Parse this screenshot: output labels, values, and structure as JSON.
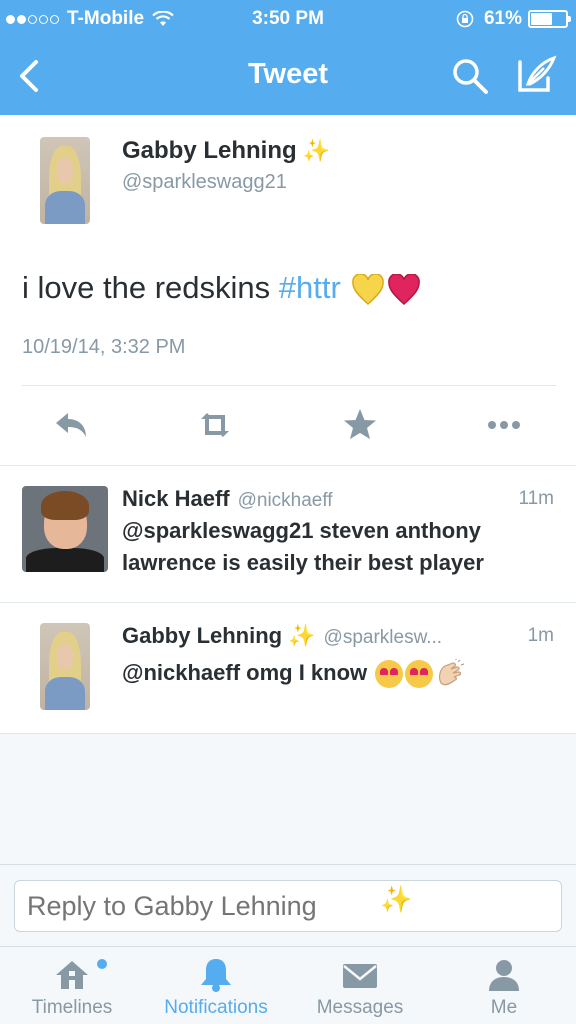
{
  "status_bar": {
    "carrier": "T-Mobile",
    "time": "3:50 PM",
    "battery": "61%",
    "battery_fraction": 0.61,
    "signal_bars_filled": 2,
    "signal_bars_total": 5
  },
  "nav": {
    "title": "Tweet"
  },
  "main_tweet": {
    "name": "Gabby Lehning",
    "name_emoji": "✨",
    "handle": "@sparkleswagg21",
    "text": "i love the redskins ",
    "hashtag": "#httr",
    "timestamp": "10/19/14, 3:32 PM"
  },
  "replies": [
    {
      "name": "Nick Haeff",
      "handle": "@nickhaeff",
      "time": "11m",
      "text": "@sparkleswagg21 steven anthony lawrence is easily their best player"
    },
    {
      "name": "Gabby Lehning",
      "name_emoji": "✨",
      "handle": "@sparklesw...",
      "time": "1m",
      "text": "@nickhaeff omg I know "
    }
  ],
  "reply_box": {
    "placeholder": "Reply to Gabby Lehning",
    "emoji": "✨"
  },
  "tabs": [
    {
      "label": "Timelines",
      "icon": "home-icon",
      "active": false,
      "has_badge": true
    },
    {
      "label": "Notifications",
      "icon": "bell-icon",
      "active": true,
      "has_badge": false
    },
    {
      "label": "Messages",
      "icon": "envelope-icon",
      "active": false,
      "has_badge": false
    },
    {
      "label": "Me",
      "icon": "person-icon",
      "active": false,
      "has_badge": false
    }
  ],
  "colors": {
    "brand_blue": "#55acee",
    "text_dark": "#292f33",
    "text_gray": "#8899a6",
    "divider": "#e1e8ed"
  }
}
